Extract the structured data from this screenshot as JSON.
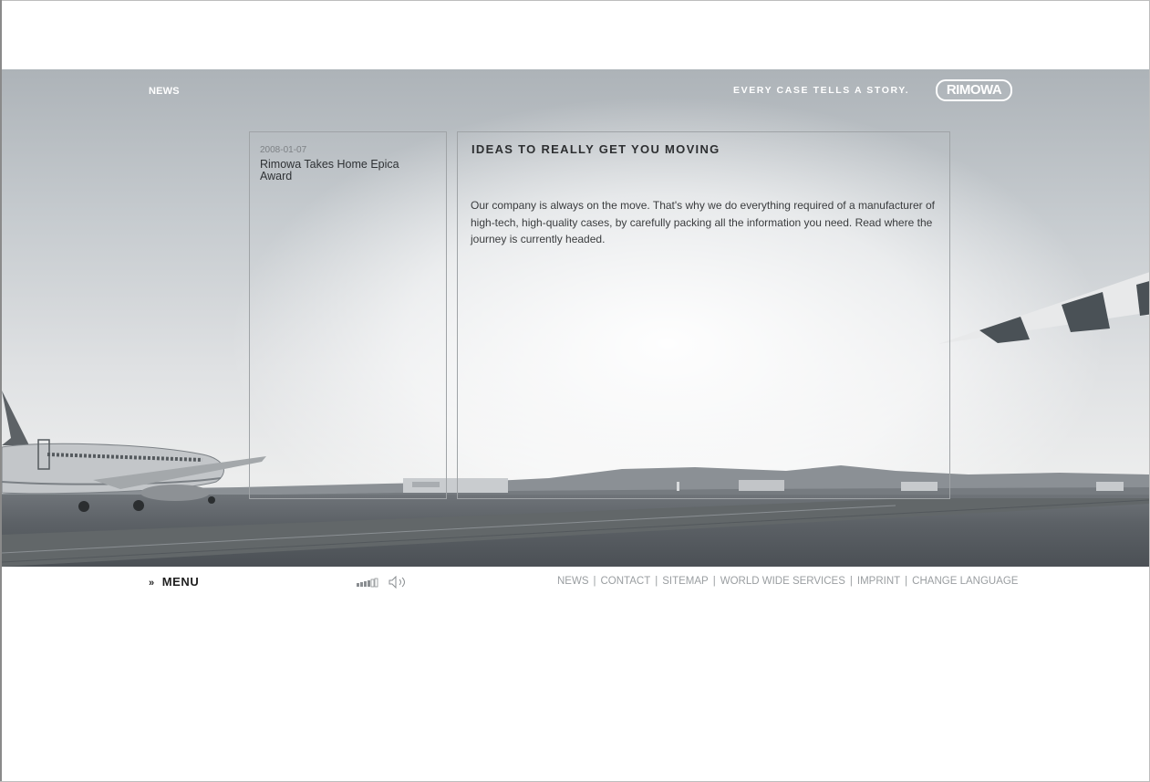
{
  "header": {
    "section_title": "NEWS",
    "slogan": "EVERY CASE TELLS A STORY.",
    "logo_text": "RIMOWA"
  },
  "news_list": {
    "items": [
      {
        "date": "2008-01-07",
        "headline": "Rimowa Takes Home Epica Award"
      }
    ]
  },
  "article": {
    "title": "IDEAS TO REALLY GET YOU MOVING",
    "body": "Our company is always on the move. That's why we do everything required of a manufacturer of high-tech, high-quality cases, by carefully packing all the information you need. Read where the journey is currently headed."
  },
  "footer": {
    "menu_arrows": "»",
    "menu_label": "MENU",
    "volume_icon": "speaker-volume-icon",
    "nav": {
      "separator": "|",
      "links": [
        "NEWS",
        "CONTACT",
        "SITEMAP",
        "WORLD WIDE SERVICES",
        "IMPRINT",
        "CHANGE LANGUAGE"
      ]
    }
  },
  "colors": {
    "text_dark": "#2f3235",
    "footer_link": "#9a9ea1",
    "panel_border": "#9fa3a6"
  }
}
